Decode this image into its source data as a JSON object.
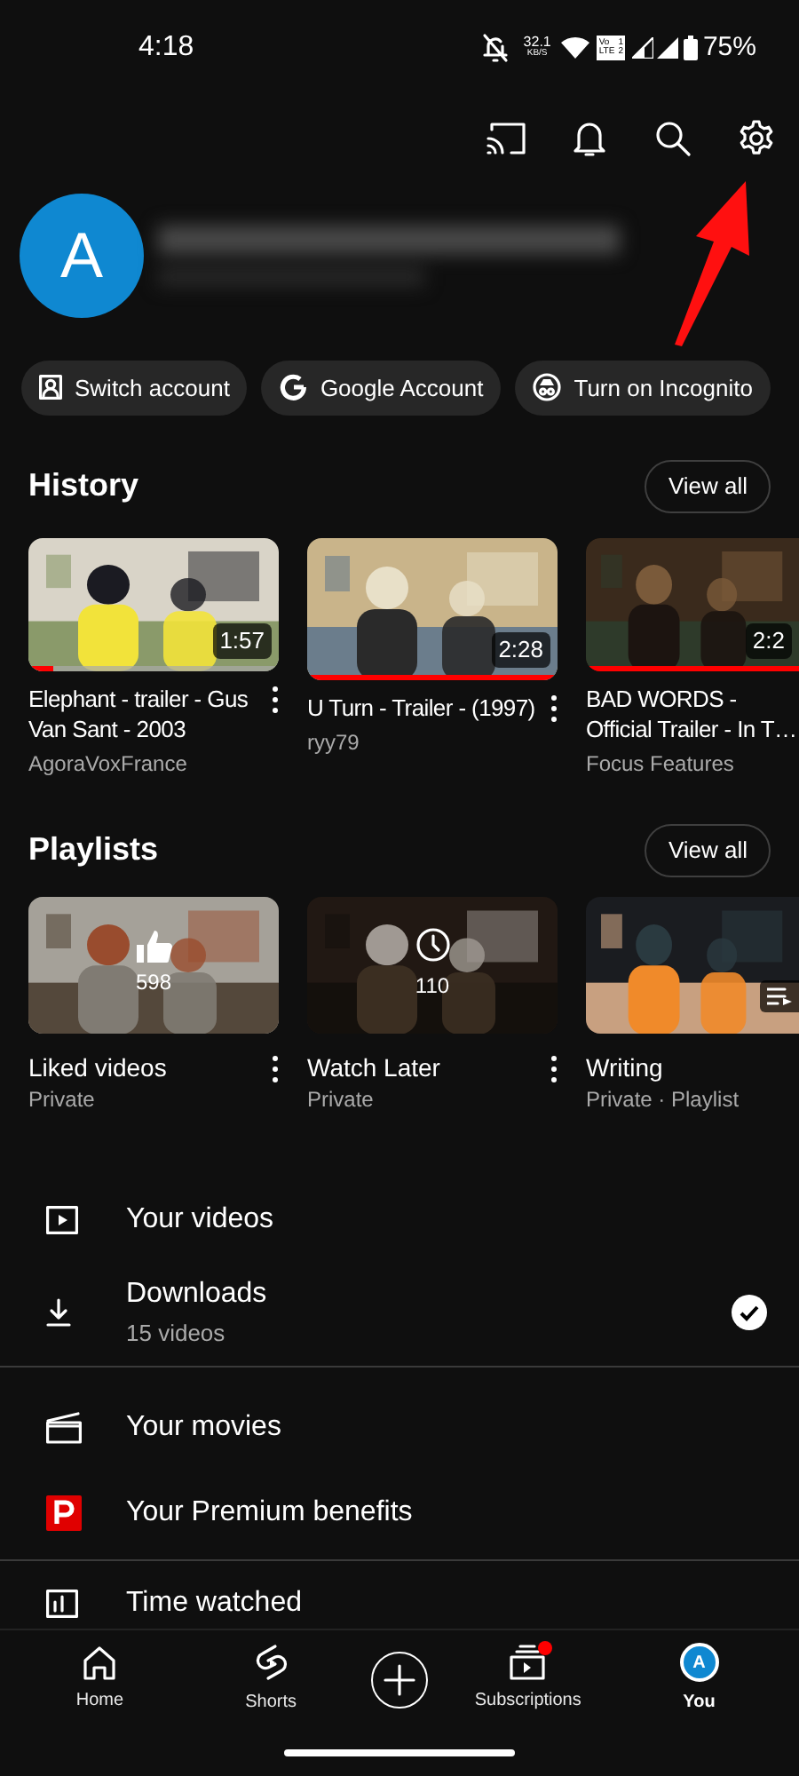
{
  "status_bar": {
    "time": "4:18",
    "net_speed": "32.1",
    "net_unit": "KB/S",
    "volte": [
      "Vo",
      "LTE"
    ],
    "sims": [
      "1",
      "2"
    ],
    "battery": "75%"
  },
  "profile": {
    "avatar_letter": "A"
  },
  "chips": [
    {
      "label": "Switch account"
    },
    {
      "label": "Google Account"
    },
    {
      "label": "Turn on Incognito"
    }
  ],
  "history": {
    "title": "History",
    "view_all": "View all",
    "videos": [
      {
        "title": "Elephant - trailer - Gus Van Sant - 2003",
        "channel": "AgoraVoxFrance",
        "duration": "1:57",
        "level": 0.1
      },
      {
        "title": "U Turn - Trailer - (1997)",
        "channel": "ryy79",
        "duration": "2:28",
        "level": 1
      },
      {
        "title": "BAD WORDS - Official Trailer - In T…",
        "channel": "Focus Features",
        "duration": "2:2",
        "level": 1
      }
    ]
  },
  "playlists": {
    "title": "Playlists",
    "view_all": "View all",
    "items": [
      {
        "kind": "liked",
        "title": "Liked videos",
        "subtitle": "Private",
        "count": "598"
      },
      {
        "kind": "watch_later",
        "title": "Watch Later",
        "subtitle": "Private",
        "count": "110"
      },
      {
        "kind": "playlist",
        "title": "Writing",
        "subtitle": "Private · Playlist"
      }
    ]
  },
  "menu": [
    {
      "label": "Your videos",
      "checked": false
    },
    {
      "label": "Downloads",
      "sublabel": "15 videos",
      "checked": true
    },
    {
      "label": "Your movies",
      "checked": false
    },
    {
      "label": "Your Premium benefits",
      "checked": false
    },
    {
      "label": "Time watched",
      "checked": false
    }
  ],
  "nav": [
    {
      "label": "Home",
      "selected": false,
      "notification": false
    },
    {
      "label": "Shorts",
      "selected": false,
      "notification": false
    },
    {
      "label": "Subscriptions",
      "selected": false,
      "notification": true
    },
    {
      "label": "You",
      "selected": true,
      "notification": false,
      "avatar_letter": "A"
    }
  ]
}
